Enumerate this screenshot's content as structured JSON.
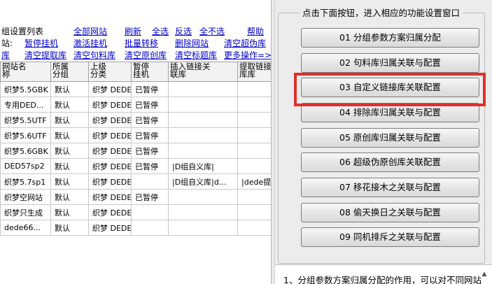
{
  "toolbar": {
    "row1": [
      {
        "id": "group-list",
        "label": "组设置列表",
        "link": false
      },
      {
        "id": "all-sites",
        "label": "全部网站",
        "link": true
      },
      {
        "id": "refresh",
        "label": "刷新",
        "link": true
      },
      {
        "id": "select-all",
        "label": "全选",
        "link": true
      },
      {
        "id": "invert",
        "label": "反选",
        "link": true
      },
      {
        "id": "select-none",
        "label": "全不选",
        "link": true
      },
      {
        "id": "help",
        "label": "帮助",
        "link": true
      }
    ],
    "row2": [
      {
        "id": "station-label",
        "label": "站:",
        "link": false
      },
      {
        "id": "pause-collect",
        "label": "暂停挂机",
        "link": true
      },
      {
        "id": "activate-collect",
        "label": "激活挂机",
        "link": true
      },
      {
        "id": "batch-transfer",
        "label": "批量转移",
        "link": true
      },
      {
        "id": "delete-site",
        "label": "删除网站",
        "link": true
      },
      {
        "id": "clear-pseudo",
        "label": "清空超伪库",
        "link": true
      }
    ],
    "row3": [
      {
        "id": "lib",
        "label": "库",
        "link": true
      },
      {
        "id": "clear-extract",
        "label": "清空提取库",
        "link": true
      },
      {
        "id": "clear-sentence",
        "label": "清空句料库",
        "link": true
      },
      {
        "id": "clear-original",
        "label": "清空原创库",
        "link": true
      },
      {
        "id": "clear-title",
        "label": "清空标题库",
        "link": true
      },
      {
        "id": "more-ops",
        "label": "更多操作=>",
        "link": true
      }
    ]
  },
  "table": {
    "headers": [
      [
        "网站名",
        "称"
      ],
      [
        "所属",
        "分组"
      ],
      [
        "上级",
        "分类"
      ],
      [
        "暂停",
        "挂机"
      ],
      [
        "插入链接关",
        "联库"
      ],
      [
        "提取链接",
        "库库"
      ]
    ],
    "rows": [
      [
        "织梦5.5GBK",
        "默认",
        "织梦 DEDE",
        "已暂停",
        "",
        ""
      ],
      [
        "专用DED...",
        "默认",
        "织梦 DEDE",
        "已暂停",
        "",
        ""
      ],
      [
        "织梦5.5UTF",
        "默认",
        "织梦 DEDE",
        "已暂停",
        "",
        ""
      ],
      [
        "织梦5.6UTF",
        "默认",
        "织梦 DEDE",
        "已暂停",
        "",
        ""
      ],
      [
        "织梦5.6GBK",
        "默认",
        "织梦 DEDE",
        "已暂停",
        "",
        ""
      ],
      [
        "DED57sp2",
        "默认",
        "织梦 DEDE",
        "已暂停",
        "|D组自义库|",
        ""
      ],
      [
        "织梦5.7sp1",
        "默认",
        "织梦 DEDE",
        "",
        "|D组自义库|d...",
        "|dede提"
      ],
      [
        "织梦空网站",
        "默认",
        "织梦 DEDE",
        "已暂停",
        "",
        ""
      ],
      [
        "织梦只生成",
        "默认",
        "织梦 DEDE",
        "",
        "",
        ""
      ],
      [
        "dede66...",
        "默认",
        "织梦 DEDE",
        "",
        "",
        ""
      ]
    ]
  },
  "panel": {
    "title": "点击下面按钮，进入相应的功能设置窗口",
    "buttons": [
      "01 分组参数方案归属分配",
      "02 句料库归属关联与配置",
      "03 自定义链接库关联配置",
      "04 排除库归属关联与配置",
      "05 原创库归属关联与配置",
      "06 超级伪原创库关联配置",
      "07 移花接木之关联与配置",
      "08 偷天换日之关联与配置",
      "09 同机排斥之关联与配置"
    ],
    "highlighted_index": 2,
    "description": "1、分组参数方案归属分配的作用，可以对不同网站",
    "highlight_color": "#e0302a"
  }
}
